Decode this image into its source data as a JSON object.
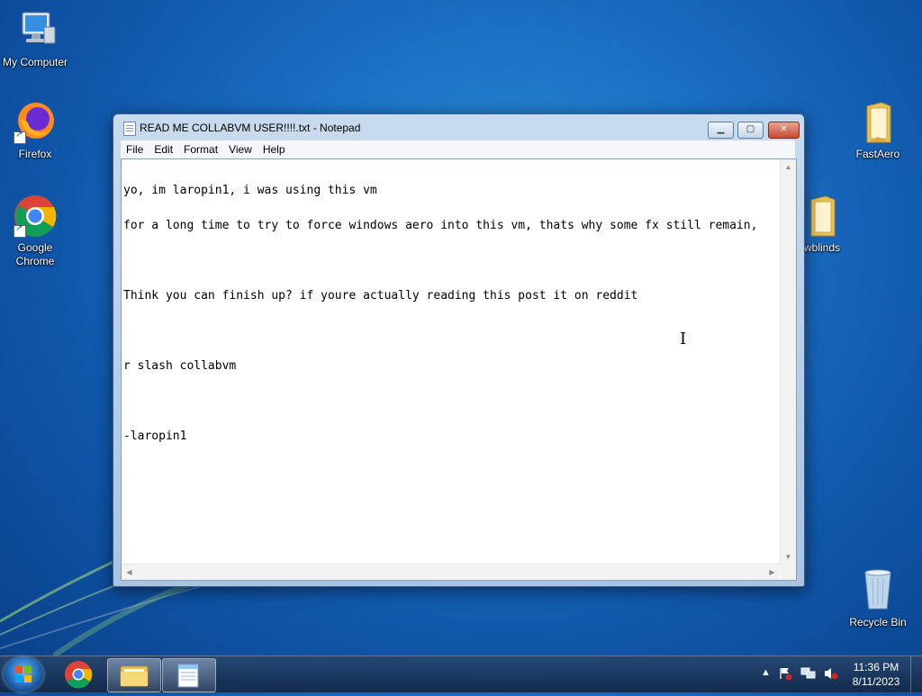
{
  "desktop": {
    "icons": {
      "my_computer": "My Computer",
      "firefox": "Firefox",
      "chrome_line1": "Google",
      "chrome_line2": "Chrome",
      "fastaero": "FastAero",
      "wblinds": "wblinds",
      "recycle_bin": "Recycle Bin"
    }
  },
  "notepad": {
    "title": "READ ME COLLABVM USER!!!!.txt - Notepad",
    "menu": [
      "File",
      "Edit",
      "Format",
      "View",
      "Help"
    ],
    "lines": [
      "yo, im laropin1, i was using this vm",
      "for a long time to try to force windows aero into this vm, thats why some fx still remain,",
      "",
      "Think you can finish up? if youre actually reading this post it on reddit",
      "",
      "r slash collabvm",
      "",
      "-laropin1"
    ]
  },
  "taskbar": {
    "clock_time": "11:36 PM",
    "clock_date": "8/11/2023"
  },
  "colors": {
    "desktop_blue": "#1a6ec3",
    "window_frame": "#a9c4e3",
    "close_button": "#c84a2f"
  }
}
